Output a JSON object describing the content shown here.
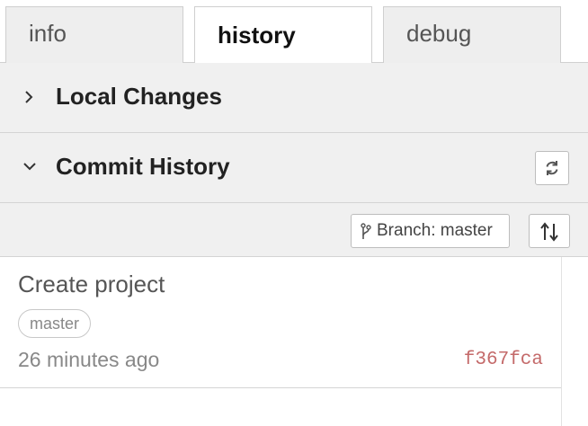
{
  "tabs": [
    {
      "label": "info",
      "active": false
    },
    {
      "label": "history",
      "active": true
    },
    {
      "label": "debug",
      "active": false
    }
  ],
  "sections": {
    "local_changes": {
      "title": "Local Changes",
      "expanded": false,
      "icon": "chevron-right-icon"
    },
    "commit_history": {
      "title": "Commit History",
      "expanded": true,
      "icon": "chevron-down-icon",
      "refresh_icon": "refresh-icon"
    }
  },
  "toolbar": {
    "branch_label": "Branch: master",
    "branch_icon": "git-branch-icon",
    "sort_icon": "sort-arrows-icon"
  },
  "commits": [
    {
      "title": "Create project",
      "branch_badge": "master",
      "time": "26 minutes ago",
      "hash": "f367fca"
    }
  ],
  "colors": {
    "hash": "#c46a6a",
    "header_bg": "#f0f0f0",
    "border": "#d4d4d4"
  }
}
